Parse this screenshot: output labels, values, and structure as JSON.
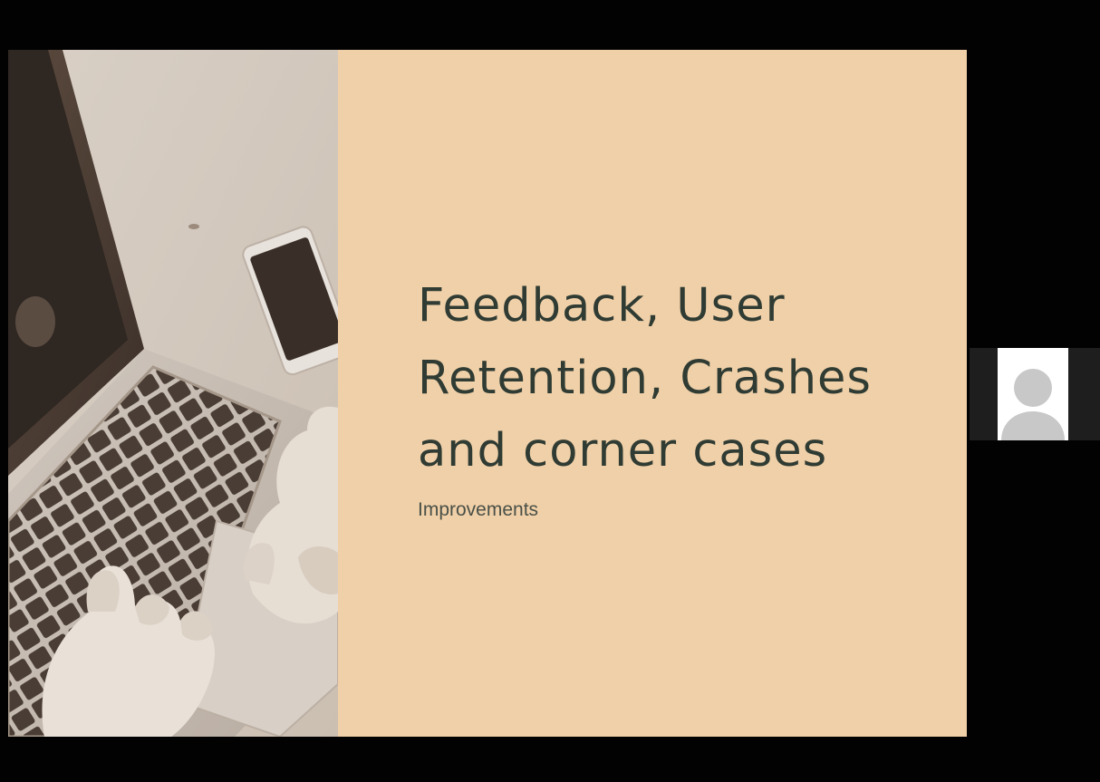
{
  "slide": {
    "title_lines": [
      "Feedback, User",
      "Retention, Crashes",
      "and corner cases"
    ],
    "subtitle": "Improvements",
    "background_color": "#f0d0a8",
    "text_color": "#2f3b33",
    "subtitle_color": "#4a5048"
  },
  "photo": {
    "subject": "laptop-keyboard-hands-photo"
  },
  "participant": {
    "avatar_icon": "user-silhouette-icon",
    "tile_color": "#1e1e1e"
  },
  "frame": {
    "background_color": "#000000"
  }
}
